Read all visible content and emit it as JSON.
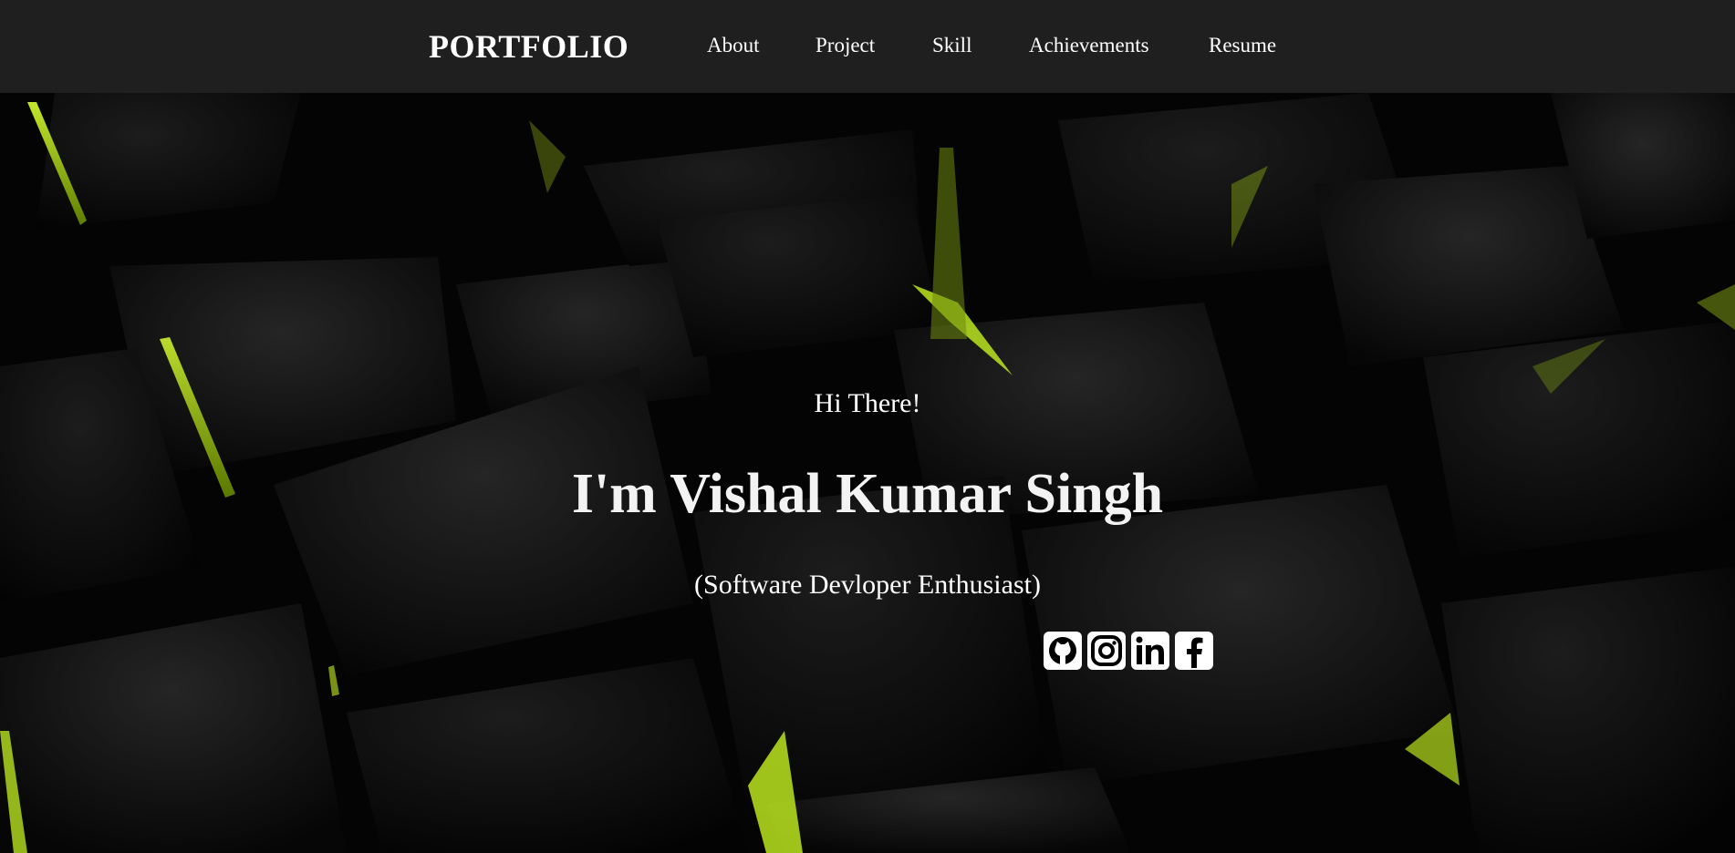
{
  "navbar": {
    "brand": "PORTFOLIO",
    "links": [
      {
        "label": "About"
      },
      {
        "label": "Project"
      },
      {
        "label": "Skill"
      },
      {
        "label": "Achievements"
      },
      {
        "label": "Resume"
      }
    ],
    "background": "#1f1f1f"
  },
  "hero": {
    "greeting": "Hi There!",
    "name": "I'm Vishal Kumar Singh",
    "role": "(Software Devloper Enthusiast)",
    "accent": "#b8ff1a",
    "socials": [
      {
        "icon": "github-icon"
      },
      {
        "icon": "instagram-icon"
      },
      {
        "icon": "linkedin-icon"
      },
      {
        "icon": "facebook-icon"
      }
    ]
  }
}
